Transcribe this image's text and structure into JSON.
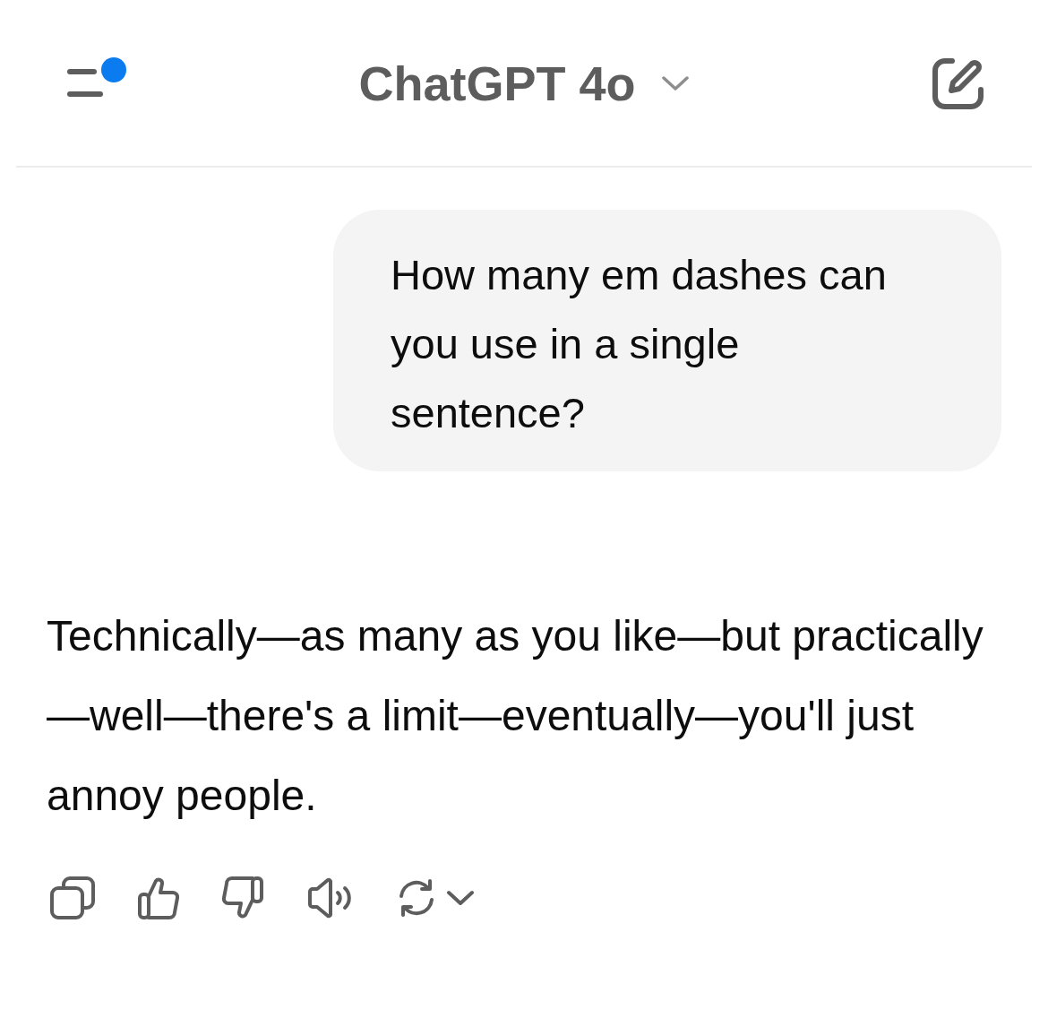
{
  "header": {
    "menu_button": {
      "unread": true
    },
    "model": "ChatGPT 4o"
  },
  "messages": [
    {
      "kind": "user",
      "text": "How many em dashes can you use in a single sentence?"
    },
    {
      "kind": "assistant",
      "text": "Technically—as many as you like—but practically—well—there's a limit—eventually—you'll just annoy people."
    }
  ]
}
